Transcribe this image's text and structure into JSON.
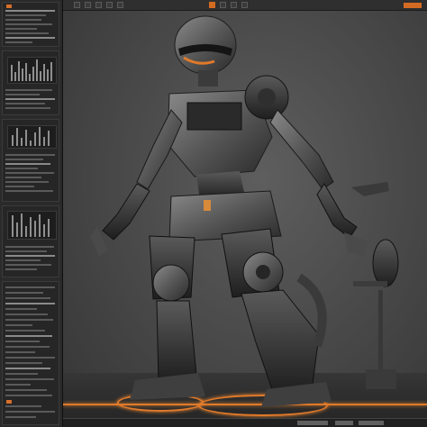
{
  "left_panel": {
    "sections": [
      "properties",
      "stack",
      "graph",
      "layers",
      "parameters"
    ]
  },
  "toolbar": {
    "tools": [
      "select",
      "move",
      "rotate",
      "scale",
      "snap",
      "render",
      "camera",
      "light",
      "grid"
    ]
  },
  "viewport": {
    "subject": "mechanical-robot",
    "accent_color": "#e17a2a",
    "floor_color": "#2d2d2d"
  },
  "status_bar": {
    "left_text": "",
    "right_text": ""
  }
}
